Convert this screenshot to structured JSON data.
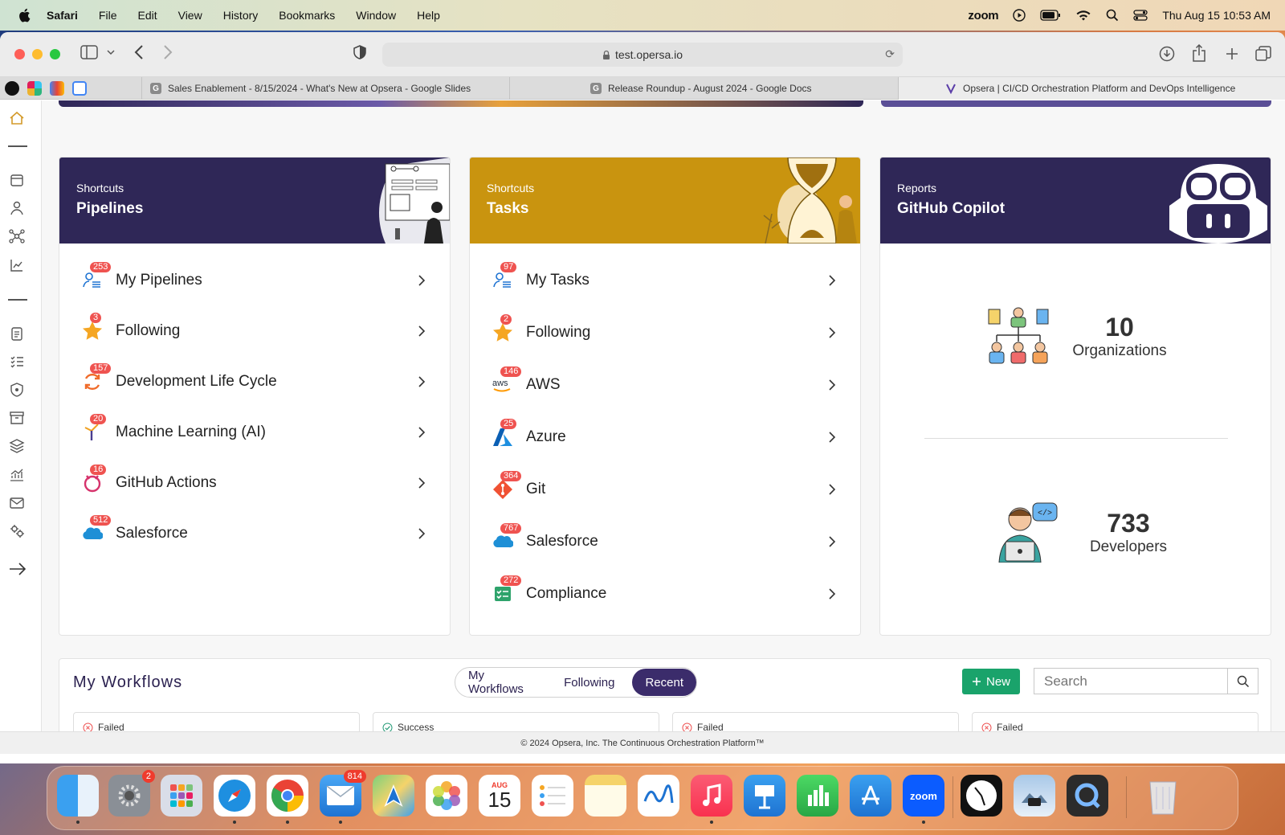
{
  "menubar": {
    "app": "Safari",
    "items": [
      "File",
      "Edit",
      "View",
      "History",
      "Bookmarks",
      "Window",
      "Help"
    ],
    "zoom": "zoom",
    "datetime": "Thu Aug 15  10:53 AM"
  },
  "browser": {
    "url": "test.opersa.io",
    "tabs": [
      {
        "label": "Sales Enablement - 8/15/2024 - What's New at Opsera - Google Slides",
        "favicon": "G"
      },
      {
        "label": "Release Roundup - August 2024 - Google Docs",
        "favicon": "G"
      },
      {
        "label": "Opsera | CI/CD Orchestration Platform and DevOps Intelligence",
        "favicon": "opsera"
      }
    ]
  },
  "pipelines_card": {
    "sub": "Shortcuts",
    "title": "Pipelines",
    "items": [
      {
        "label": "My Pipelines",
        "count": "253",
        "icon": "user-list-icon"
      },
      {
        "label": "Following",
        "count": "3",
        "icon": "star-icon"
      },
      {
        "label": "Development Life Cycle",
        "count": "157",
        "icon": "cycle-icon"
      },
      {
        "label": "Machine Learning (AI)",
        "count": "20",
        "icon": "ml-icon"
      },
      {
        "label": "GitHub Actions",
        "count": "16",
        "icon": "github-icon"
      },
      {
        "label": "Salesforce",
        "count": "512",
        "icon": "salesforce-icon"
      }
    ]
  },
  "tasks_card": {
    "sub": "Shortcuts",
    "title": "Tasks",
    "items": [
      {
        "label": "My Tasks",
        "count": "97",
        "icon": "user-list-icon"
      },
      {
        "label": "Following",
        "count": "2",
        "icon": "star-icon"
      },
      {
        "label": "AWS",
        "count": "146",
        "icon": "aws-icon"
      },
      {
        "label": "Azure",
        "count": "25",
        "icon": "azure-icon"
      },
      {
        "label": "Git",
        "count": "364",
        "icon": "git-icon"
      },
      {
        "label": "Salesforce",
        "count": "767",
        "icon": "salesforce-icon"
      },
      {
        "label": "Compliance",
        "count": "272",
        "icon": "compliance-icon"
      }
    ]
  },
  "reports_card": {
    "sub": "Reports",
    "title": "GitHub Copilot",
    "stats": [
      {
        "value": "10",
        "label": "Organizations"
      },
      {
        "value": "733",
        "label": "Developers"
      }
    ]
  },
  "workflows": {
    "title": "My Workflows",
    "segments": [
      "My Workflows",
      "Following",
      "Recent"
    ],
    "active_segment": "Recent",
    "new_label": "New",
    "search_placeholder": "Search",
    "cards": [
      {
        "status": "Failed"
      },
      {
        "status": "Success"
      },
      {
        "status": "Failed"
      },
      {
        "status": "Failed"
      }
    ]
  },
  "footer": "© 2024 Opsera, Inc. The Continuous Orchestration Platform™",
  "dock": {
    "settings_badge": "2",
    "mail_badge": "814",
    "calendar_month": "AUG",
    "calendar_day": "15",
    "zoom_label": "zoom"
  },
  "colors": {
    "navy": "#2f2757",
    "gold": "#c9940f",
    "badge": "#ef5350",
    "green": "#1aa36b"
  }
}
